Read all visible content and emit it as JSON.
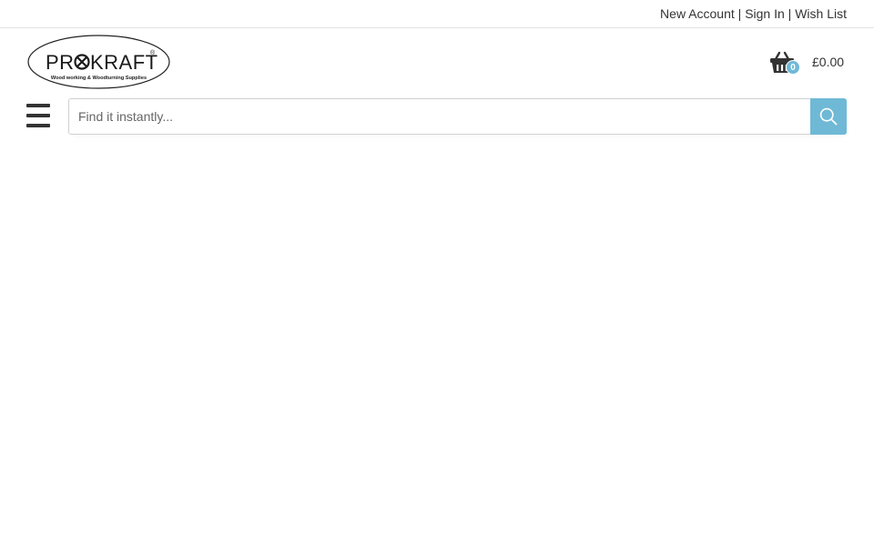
{
  "topbar": {
    "links": {
      "new_account": "New Account",
      "sign_in": "Sign In",
      "wish_list": "Wish List"
    },
    "separator": "|"
  },
  "logo": {
    "brand": "PR⊗KRAFT",
    "registered": "®",
    "tagline": "Wood working & Woodturning Supplies"
  },
  "cart": {
    "icon": "basket-icon",
    "count": "0",
    "total": "£0.00"
  },
  "search": {
    "placeholder": "Find it instantly...",
    "value": "",
    "button_icon": "search-icon"
  },
  "menu": {
    "icon": "hamburger-menu-icon"
  },
  "colors": {
    "accent": "#6fb9d6",
    "text": "#333333",
    "border": "#d0d0d0"
  }
}
